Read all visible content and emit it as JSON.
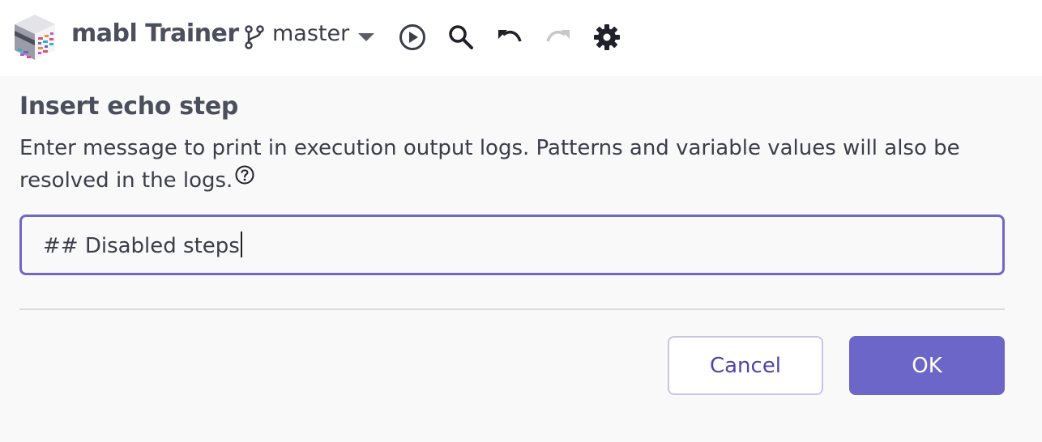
{
  "app": {
    "title": "mabl Trainer",
    "branch": "master",
    "logo_icon": "mabl-cube-logo"
  },
  "toolbar": {
    "icons": [
      "branch-icon",
      "dropdown-caret-icon",
      "play-circle-icon",
      "search-icon",
      "undo-icon",
      "redo-icon",
      "gear-icon"
    ],
    "redo_enabled": false
  },
  "dialog": {
    "title": "Insert echo step",
    "description": "Enter message to print in execution output logs. Patterns and variable values will also be resolved in the logs.",
    "help_icon": "question-circle-icon",
    "input_value": "## Disabled steps",
    "cancel_label": "Cancel",
    "ok_label": "OK"
  },
  "colors": {
    "accent": "#6c66c8",
    "input_border": "#7067c9",
    "cancel_text": "#4e45a8",
    "text": "#3b3d4a",
    "background": "#f9f9f9"
  }
}
